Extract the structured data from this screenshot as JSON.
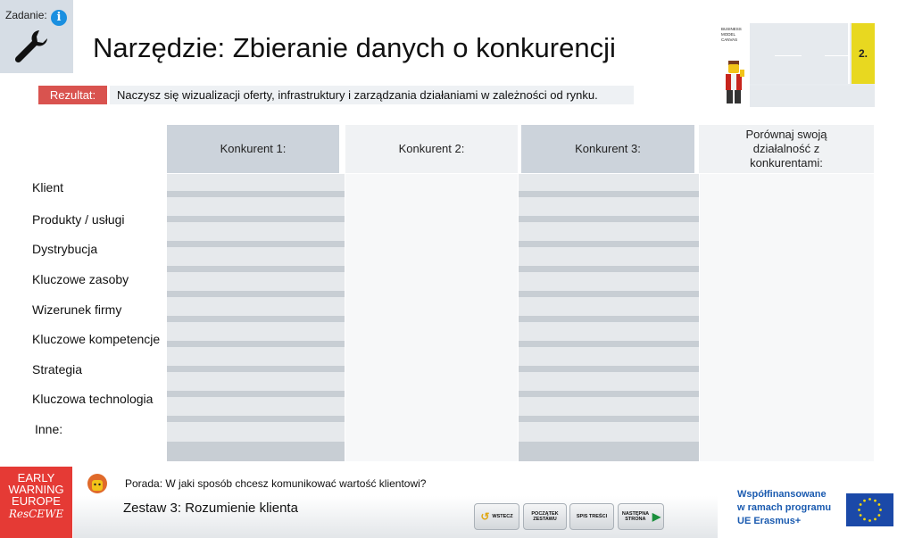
{
  "task": {
    "label": "Zadanie:",
    "info": "i"
  },
  "title": "Narzędzie: Zbieranie danych o konkurencji",
  "result": {
    "label": "Rezultat:",
    "text": "Naczysz się wizualizacji oferty, infrastruktury i zarządzania działaniami w zależności od rynku."
  },
  "bmc": {
    "lines": [
      "BUSINESS",
      "MODEL",
      "CANVAS"
    ],
    "number": "2."
  },
  "table": {
    "headers": [
      "Konkurent 1:",
      "Konkurent 2:",
      "Konkurent 3:",
      "Porównaj swoją działalność z konkurentami:"
    ],
    "rows": [
      "Klient",
      "Produkty / usługi",
      "Dystrybucja",
      "Kluczowe zasoby",
      "Wizerunek firmy",
      "Kluczowe kompetencje",
      "Strategia",
      "Kluczowa technologia",
      "Inne:"
    ]
  },
  "footer": {
    "logo": [
      "EARLY",
      "WARNING",
      "EUROPE",
      "ResCEWE"
    ],
    "hint": "Porada: W jaki sposób chcesz komunikować wartość klientowi?",
    "set_title": "Zestaw 3: Rozumienie klienta",
    "buttons": {
      "back": "WSTECZ",
      "start": "POCZĄTEK ZESTAWU",
      "toc": "SPIS TREŚCI",
      "next": "NASTĘPNA STRONA"
    },
    "funding": [
      "Współfinansowane",
      "w ramach programu",
      "UE Erasmus+"
    ]
  },
  "colors": {
    "accent_red": "#e53a35",
    "info_blue": "#1a8fe0",
    "funding_blue": "#1b5bb0",
    "bmc_yellow": "#e8d820"
  }
}
